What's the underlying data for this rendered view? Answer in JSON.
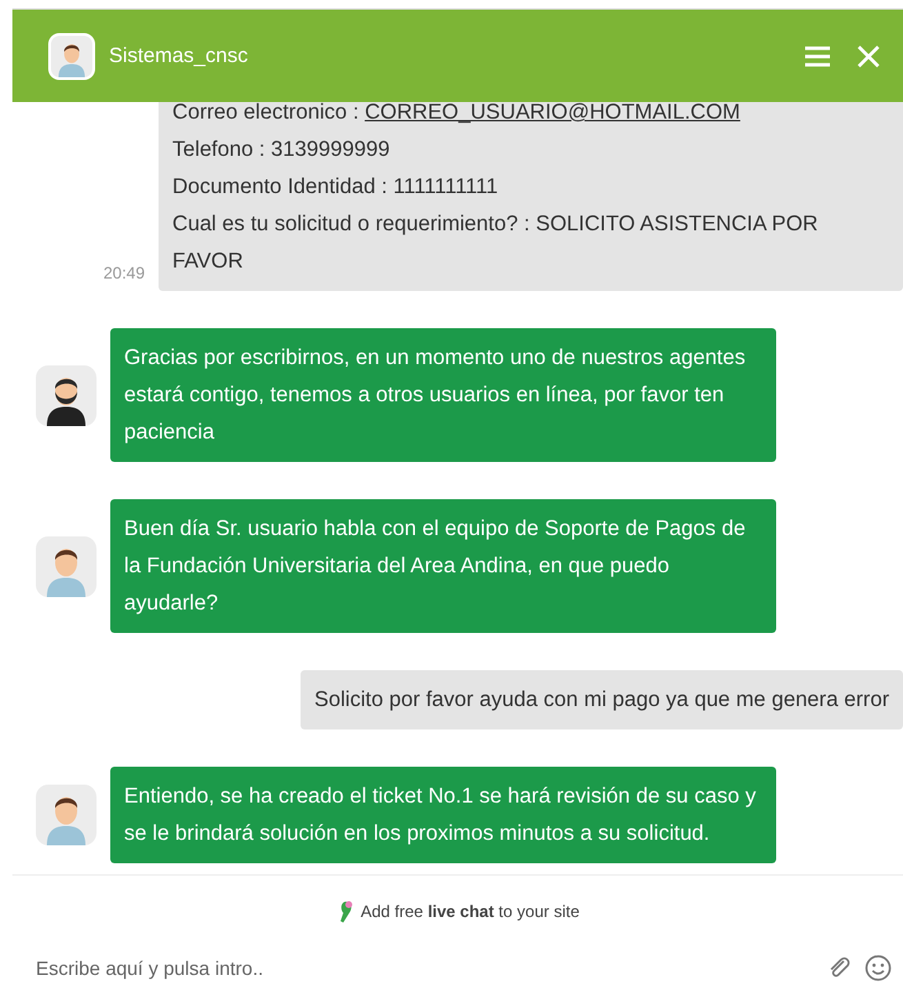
{
  "header": {
    "title": "Sistemas_cnsc"
  },
  "messages": [
    {
      "kind": "visitor",
      "time": "20:49",
      "lines": [
        {
          "label": "Correo electronico : ",
          "link": "CORREO_USUARIO@HOTMAIL.COM"
        },
        {
          "label": "Telefono : 3139999999"
        },
        {
          "label": "Documento Identidad : 1111111111"
        },
        {
          "label": "Cual es tu solicitud o requerimiento? : SOLICITO ASISTENCIA POR FAVOR"
        }
      ]
    },
    {
      "kind": "agent",
      "avatar": {
        "kind": "bearded"
      },
      "text": "Gracias por escribirnos, en un momento uno de nuestros agentes estará contigo, tenemos a otros usuarios en línea, por favor ten paciencia"
    },
    {
      "kind": "agent",
      "avatar": {
        "kind": "plain"
      },
      "text": "Buen día Sr. usuario habla con el equipo de Soporte de Pagos de la Fundación Universitaria del Area Andina, en que puedo ayudarle?"
    },
    {
      "kind": "visitor",
      "lines": [
        {
          "label": "Solicito por favor ayuda con mi pago ya que me genera error"
        }
      ]
    },
    {
      "kind": "agent",
      "avatar": {
        "kind": "plain"
      },
      "text": "Entiendo, se ha creado el ticket No.1 se hará revisión de su caso y se le brindará solución en los proximos minutos a su solicitud."
    }
  ],
  "branding": "Add free **live chat** to your site",
  "composer": {
    "placeholder": "Escribe aquí y pulsa intro.."
  }
}
